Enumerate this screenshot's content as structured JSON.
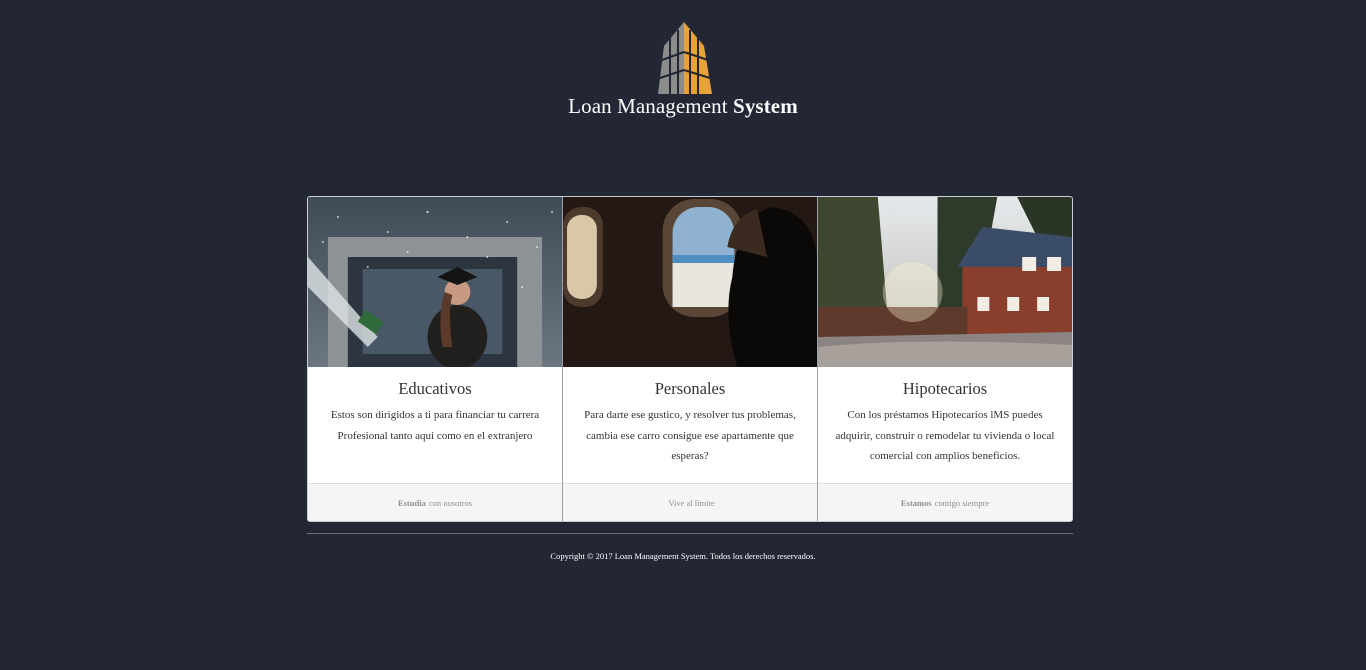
{
  "brand": {
    "name_regular": "Loan Management ",
    "name_bold": "System"
  },
  "cards": [
    {
      "image": "graduation-photo",
      "title": "Educativos",
      "text": "Estos son dirigidos a ti para financiar tu carrera Profesional tanto aqui como en el extranjero",
      "footer_bold": "Estudia",
      "footer_rest": "con nosotros"
    },
    {
      "image": "airplane-window-photo",
      "title": "Personales",
      "text": "Para darte ese gustico, y resolver tus problemas, cambia ese carro consigue ese apartamente que esperas?",
      "footer_bold": "",
      "footer_rest": "Vive al límite"
    },
    {
      "image": "house-photo",
      "title": "Hipotecarios",
      "text": "Con los préstamos Hipotecarios lMS puedes adquirir, construir o remodelar tu vivienda o local comercial con amplios beneficios.",
      "footer_bold": "Estamos",
      "footer_rest": "contigo siempre"
    }
  ],
  "footer": {
    "copyright": "Copyright © 2017 Loan Management System. Todos los derechos reservados."
  },
  "colors": {
    "background": "#232634",
    "logo_orange": "#e9a13b",
    "logo_gray": "#8a8a8a"
  }
}
